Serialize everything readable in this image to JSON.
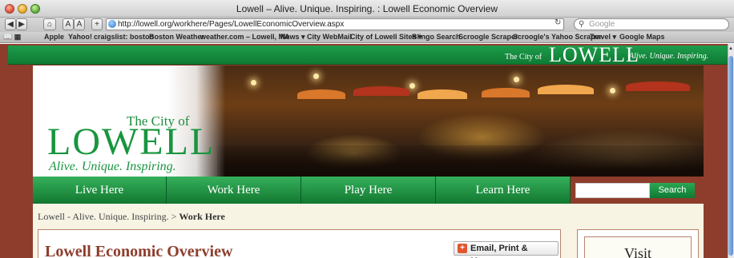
{
  "browser": {
    "window_title": "Lowell – Alive. Unique. Inspiring. : Lowell Economic Overview",
    "url": "http://lowell.org/workhere/Pages/LowellEconomicOverview.aspx",
    "search_placeholder": "Google",
    "nav_buttons": {
      "back": "◀",
      "forward": "▶",
      "home": "⌂",
      "text_smaller": "A",
      "text_larger": "A",
      "add": "+"
    },
    "reload_icon": "reload-icon",
    "bookmarks": [
      "Apple",
      "Yahoo!",
      "craigslist: boston",
      "Boston Weather",
      "weather.com – Lowell, MA",
      "News ▾",
      "City WebMail",
      "City of Lowell Sites ▾",
      "Blingo Search",
      "Scroogle Scraper",
      "Scroogle's Yahoo Scraper",
      "Travel ▾",
      "Google Maps"
    ]
  },
  "site": {
    "top_strip": {
      "small": "The City of",
      "big": "LOWELL",
      "tagline": "Alive. Unique. Inspiring."
    },
    "logo": {
      "small": "The City of",
      "big": "LOWELL",
      "tagline": "Alive. Unique. Inspiring."
    },
    "nav": [
      "Live Here",
      "Work Here",
      "Play Here",
      "Learn Here"
    ],
    "search_button": "Search",
    "colors": {
      "brand_green": "#19953f",
      "brick": "#8e3d2c",
      "cream": "#f7f4e4"
    }
  },
  "content": {
    "breadcrumb_parent": "Lowell - Alive. Unique. Inspiring.",
    "breadcrumb_sep": ">",
    "breadcrumb_current": "Work Here",
    "title": "Lowell Economic Overview",
    "email_button": "Email, Print & More...",
    "sidebar_heading": "Visit"
  }
}
